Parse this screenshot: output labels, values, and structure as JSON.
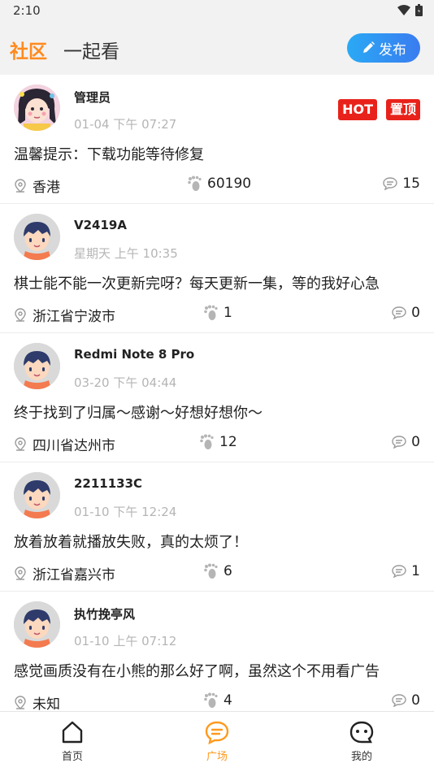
{
  "status_bar": {
    "time": "2:10"
  },
  "header": {
    "tab_community": "社区",
    "tab_together": "一起看",
    "publish_label": "发布"
  },
  "posts": [
    {
      "user": "管理员",
      "time": "01-04 下午 07:27",
      "content": "温馨提示：下载功能等待修复",
      "location": "香港",
      "views": "60190",
      "comments": "15",
      "badges": [
        "HOT",
        "置顶"
      ],
      "avatar": "girl-avatar"
    },
    {
      "user": "V2419A",
      "time": "星期天 上午 10:35",
      "content": "棋士能不能一次更新完呀？每天更新一集，等的我好心急",
      "location": "浙江省宁波市",
      "views": "1",
      "comments": "0",
      "avatar": "boy-avatar"
    },
    {
      "user": "Redmi Note 8 Pro",
      "time": "03-20 下午 04:44",
      "content": "终于找到了归属～感谢～好想好想你～",
      "location": "四川省达州市",
      "views": "12",
      "comments": "0",
      "avatar": "boy-avatar"
    },
    {
      "user": "2211133C",
      "time": "01-10 下午 12:24",
      "content": "放着放着就播放失败，真的太烦了！",
      "location": "浙江省嘉兴市",
      "views": "6",
      "comments": "1",
      "avatar": "boy-avatar"
    },
    {
      "user": "执竹挽亭风",
      "time": "01-10 上午 07:12",
      "content": "感觉画质没有在小熊的那么好了啊，虽然这个不用看广告",
      "location": "未知",
      "views": "4",
      "comments": "0",
      "avatar": "boy-avatar"
    }
  ],
  "nav": {
    "home": "首页",
    "square": "广场",
    "mine": "我的"
  },
  "colors": {
    "accent": "#ff8a1e",
    "badge": "#e8221b",
    "publish": "#2aa9f5"
  }
}
